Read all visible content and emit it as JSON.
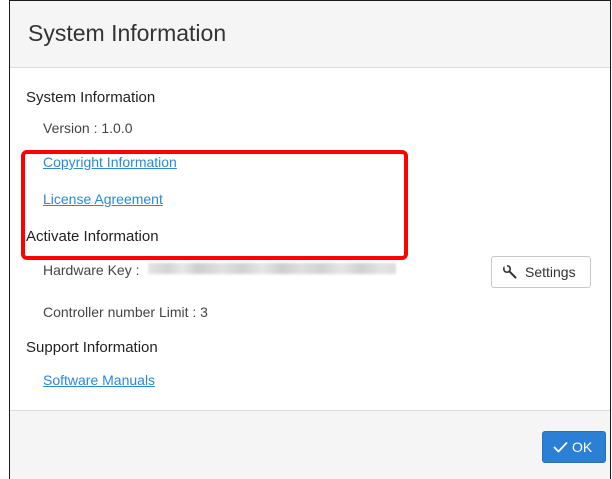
{
  "dialog": {
    "title": "System Information"
  },
  "system": {
    "heading": "System Information",
    "version": "Version : 1.0.0",
    "copyright_link": "Copyright Information",
    "license_link": "License Agreement"
  },
  "activate": {
    "heading": "Activate Information",
    "hardware_key_label": "Hardware Key :",
    "controller_limit": "Controller number Limit : 3",
    "settings_label": "Settings",
    "settings_icon": "wrench-icon"
  },
  "support": {
    "heading": "Support Information",
    "manuals_link": "Software Manuals"
  },
  "footer": {
    "ok_label": "OK",
    "ok_icon": "check-icon"
  },
  "colors": {
    "accent": "#2b7fd4",
    "link": "#2a88d8",
    "highlight": "#ff0000"
  }
}
